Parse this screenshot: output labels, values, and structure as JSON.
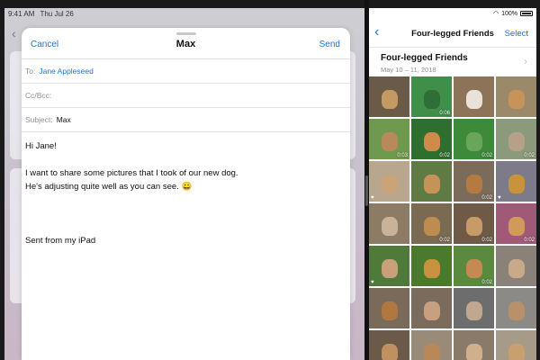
{
  "left_status": {
    "time": "9:41 AM",
    "date": "Thu Jul 26"
  },
  "compose": {
    "cancel_label": "Cancel",
    "title": "Max",
    "send_label": "Send",
    "to_label": "To:",
    "to_value": "Jane Appleseed",
    "cc_label": "Cc/Bcc:",
    "subject_label": "Subject:",
    "subject_value": "Max",
    "body": {
      "greeting": "Hi Jane!",
      "line1": "I want to share some pictures that I took of our new dog.",
      "line2": "He's adjusting quite well as you can see. 😀",
      "signature": "Sent from my iPad"
    }
  },
  "right_status": {
    "battery": "100%"
  },
  "photos": {
    "nav_title": "Four-legged Friends",
    "select_label": "Select",
    "moment_title": "Four-legged Friends",
    "moment_date": "May 10 – 11, 2018",
    "cells": [
      {
        "bg": "#6a5a48",
        "dog": "#c49a64",
        "badge": ""
      },
      {
        "bg": "#3f8f4a",
        "dog": "#2f6e36",
        "badge": "0:06"
      },
      {
        "bg": "#8d7458",
        "dog": "#e8e2d8",
        "badge": ""
      },
      {
        "bg": "#9b8a6a",
        "dog": "#c7935a",
        "badge": ""
      },
      {
        "bg": "#6f9a4d",
        "dog": "#b88a5a",
        "badge": "0:03"
      },
      {
        "bg": "#2e6f30",
        "dog": "#d08a4a",
        "badge": "0:02"
      },
      {
        "bg": "#3d8a3a",
        "dog": "#6aa65a",
        "badge": "0:02"
      },
      {
        "bg": "#8a9a7a",
        "dog": "#b6a088",
        "badge": "0:02"
      },
      {
        "bg": "#b8a78e",
        "dog": "#c9a478",
        "badge": "♥"
      },
      {
        "bg": "#5f7a44",
        "dog": "#c59358",
        "badge": ""
      },
      {
        "bg": "#7a6b5a",
        "dog": "#b47a42",
        "badge": "0:02"
      },
      {
        "bg": "#7d7b8a",
        "dog": "#c9933a",
        "badge": "♥"
      },
      {
        "bg": "#8c7c66",
        "dog": "#c8b298",
        "badge": ""
      },
      {
        "bg": "#7a6a52",
        "dog": "#bf8c50",
        "badge": "0:02"
      },
      {
        "bg": "#6f5a48",
        "dog": "#c79a68",
        "badge": "0:02"
      },
      {
        "bg": "#a05a78",
        "dog": "#d29a58",
        "badge": "0:02"
      },
      {
        "bg": "#4f7a3a",
        "dog": "#caa07a",
        "badge": "♥"
      },
      {
        "bg": "#4a7a2e",
        "dog": "#c9923e",
        "badge": ""
      },
      {
        "bg": "#5a8a40",
        "dog": "#c58a52",
        "badge": "0:02"
      },
      {
        "bg": "#8a8278",
        "dog": "#c8aa8a",
        "badge": ""
      },
      {
        "bg": "#7a6a5a",
        "dog": "#b07840",
        "badge": ""
      },
      {
        "bg": "#7b6b5c",
        "dog": "#c8a080",
        "badge": ""
      },
      {
        "bg": "#6d6d6d",
        "dog": "#c0a890",
        "badge": ""
      },
      {
        "bg": "#8c8a86",
        "dog": "#b8906a",
        "badge": ""
      },
      {
        "bg": "#6b5a4a",
        "dog": "#c09060",
        "badge": ""
      },
      {
        "bg": "#9a8a78",
        "dog": "#b88858",
        "badge": ""
      },
      {
        "bg": "#8a7a6a",
        "dog": "#d0b08a",
        "badge": ""
      },
      {
        "bg": "#a89a88",
        "dog": "#c8a070",
        "badge": ""
      }
    ]
  }
}
